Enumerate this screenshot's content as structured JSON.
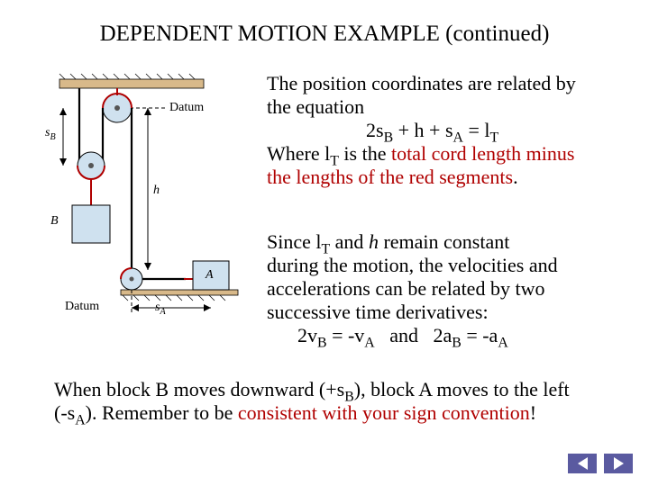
{
  "title": "DEPENDENT MOTION EXAMPLE (continued)",
  "diagram": {
    "datum_top": "Datum",
    "datum_bottom": "Datum",
    "sB": "s",
    "sB_sub": "B",
    "sA": "s",
    "sA_sub": "A",
    "h": "h",
    "blockA": "A",
    "blockB": "B"
  },
  "p1": {
    "l1": "The position coordinates are related by",
    "l2": "the equation",
    "eq_a": "2s",
    "eq_b": "B",
    "eq_c": " + h + s",
    "eq_d": "A",
    "eq_e": " = l",
    "eq_f": "T",
    "l3a": "Where l",
    "l3b": "T",
    "l3c": " is the ",
    "l3_red": "total cord length minus",
    "l4_red": "the lengths of the red segments",
    "period": "."
  },
  "p2": {
    "l1a": "Since l",
    "l1b": "T",
    "l1c": " and ",
    "l1d": "h",
    "l1e": " remain constant",
    "l2": "during the motion, the velocities and",
    "l3": "accelerations can be related by two",
    "l4": "successive time derivatives:",
    "eqL_a": "2v",
    "eqL_b": "B",
    "eqL_c": " = -v",
    "eqL_d": "A",
    "mid": "   and   ",
    "eqR_a": "2a",
    "eqR_b": "B",
    "eqR_c": " = -a",
    "eqR_d": "A"
  },
  "p3": {
    "l1a": "When block B moves downward (+s",
    "l1b": "B",
    "l1c": "), block A moves to the left",
    "l2a": "(-s",
    "l2b": "A",
    "l2c": ").  Remember to be ",
    "l2_red": "consistent with your sign convention",
    "l2d": "!"
  },
  "nav": {
    "prev": "previous",
    "next": "next"
  }
}
